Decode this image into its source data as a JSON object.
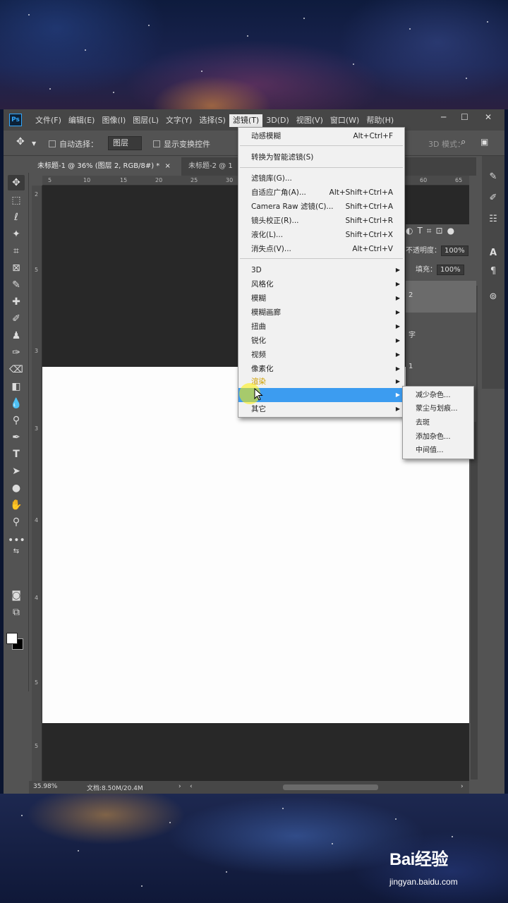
{
  "watermark": {
    "logo": "Bai经验",
    "url": "jingyan.baidu.com"
  },
  "app": {
    "logo": "Ps",
    "win_min": "─",
    "win_max": "☐",
    "win_close": "✕"
  },
  "menubar": [
    {
      "label": "文件(F)"
    },
    {
      "label": "编辑(E)"
    },
    {
      "label": "图像(I)"
    },
    {
      "label": "图层(L)"
    },
    {
      "label": "文字(Y)"
    },
    {
      "label": "选择(S)"
    },
    {
      "label": "滤镜(T)"
    },
    {
      "label": "3D(D)"
    },
    {
      "label": "视图(V)"
    },
    {
      "label": "窗口(W)"
    },
    {
      "label": "帮助(H)"
    }
  ],
  "options": {
    "auto_select_label": "自动选择：",
    "auto_select_value": "图层",
    "show_transform_label": "显示变换控件",
    "mode_3d_label": "3D 模式："
  },
  "doc_tabs": [
    {
      "label": "未标题-1 @ 36% (图层 2, RGB/8#) *",
      "close": "×"
    },
    {
      "label": "未标题-2 @ 1"
    }
  ],
  "ruler": {
    "h": [
      "5",
      "10",
      "15",
      "20",
      "25",
      "30",
      "60",
      "65"
    ],
    "v": [
      "2",
      "5",
      "3",
      "3",
      "4",
      "4",
      "5",
      "5"
    ]
  },
  "layers_panel": {
    "opacity_label": "不透明度：",
    "opacity_value": "100%",
    "fill_label": "填充：",
    "fill_value": "100%",
    "layer_num_1": "2",
    "layer_num_2": "字",
    "layer_num_3": "1"
  },
  "status": {
    "zoom": "35.98%",
    "doc": "文档:8.50M/20.4M"
  },
  "filter_menu": {
    "items": [
      {
        "label": "动感模糊",
        "shortcut": "Alt+Ctrl+F"
      },
      {
        "label": "转换为智能滤镜(S)"
      },
      {
        "label": "滤镜库(G)..."
      },
      {
        "label": "自适应广角(A)...",
        "shortcut": "Alt+Shift+Ctrl+A"
      },
      {
        "label": "Camera Raw 滤镜(C)...",
        "shortcut": "Shift+Ctrl+A"
      },
      {
        "label": "镜头校正(R)...",
        "shortcut": "Shift+Ctrl+R"
      },
      {
        "label": "液化(L)...",
        "shortcut": "Shift+Ctrl+X"
      },
      {
        "label": "消失点(V)...",
        "shortcut": "Alt+Ctrl+V"
      },
      {
        "label": "3D"
      },
      {
        "label": "风格化"
      },
      {
        "label": "模糊"
      },
      {
        "label": "模糊画廊"
      },
      {
        "label": "扭曲"
      },
      {
        "label": "锐化"
      },
      {
        "label": "视频"
      },
      {
        "label": "像素化"
      },
      {
        "label": "渲染"
      },
      {
        "label": ""
      },
      {
        "label": "其它"
      }
    ]
  },
  "noise_submenu": {
    "items": [
      {
        "label": "减少杂色..."
      },
      {
        "label": "蒙尘与划痕..."
      },
      {
        "label": "去斑"
      },
      {
        "label": "添加杂色..."
      },
      {
        "label": "中间值..."
      }
    ]
  },
  "colors": {
    "highlight": "#3c9cf0",
    "menu_bg": "#f1f1f1",
    "app_bg": "#535353",
    "canvas": "#fdfdfd"
  }
}
